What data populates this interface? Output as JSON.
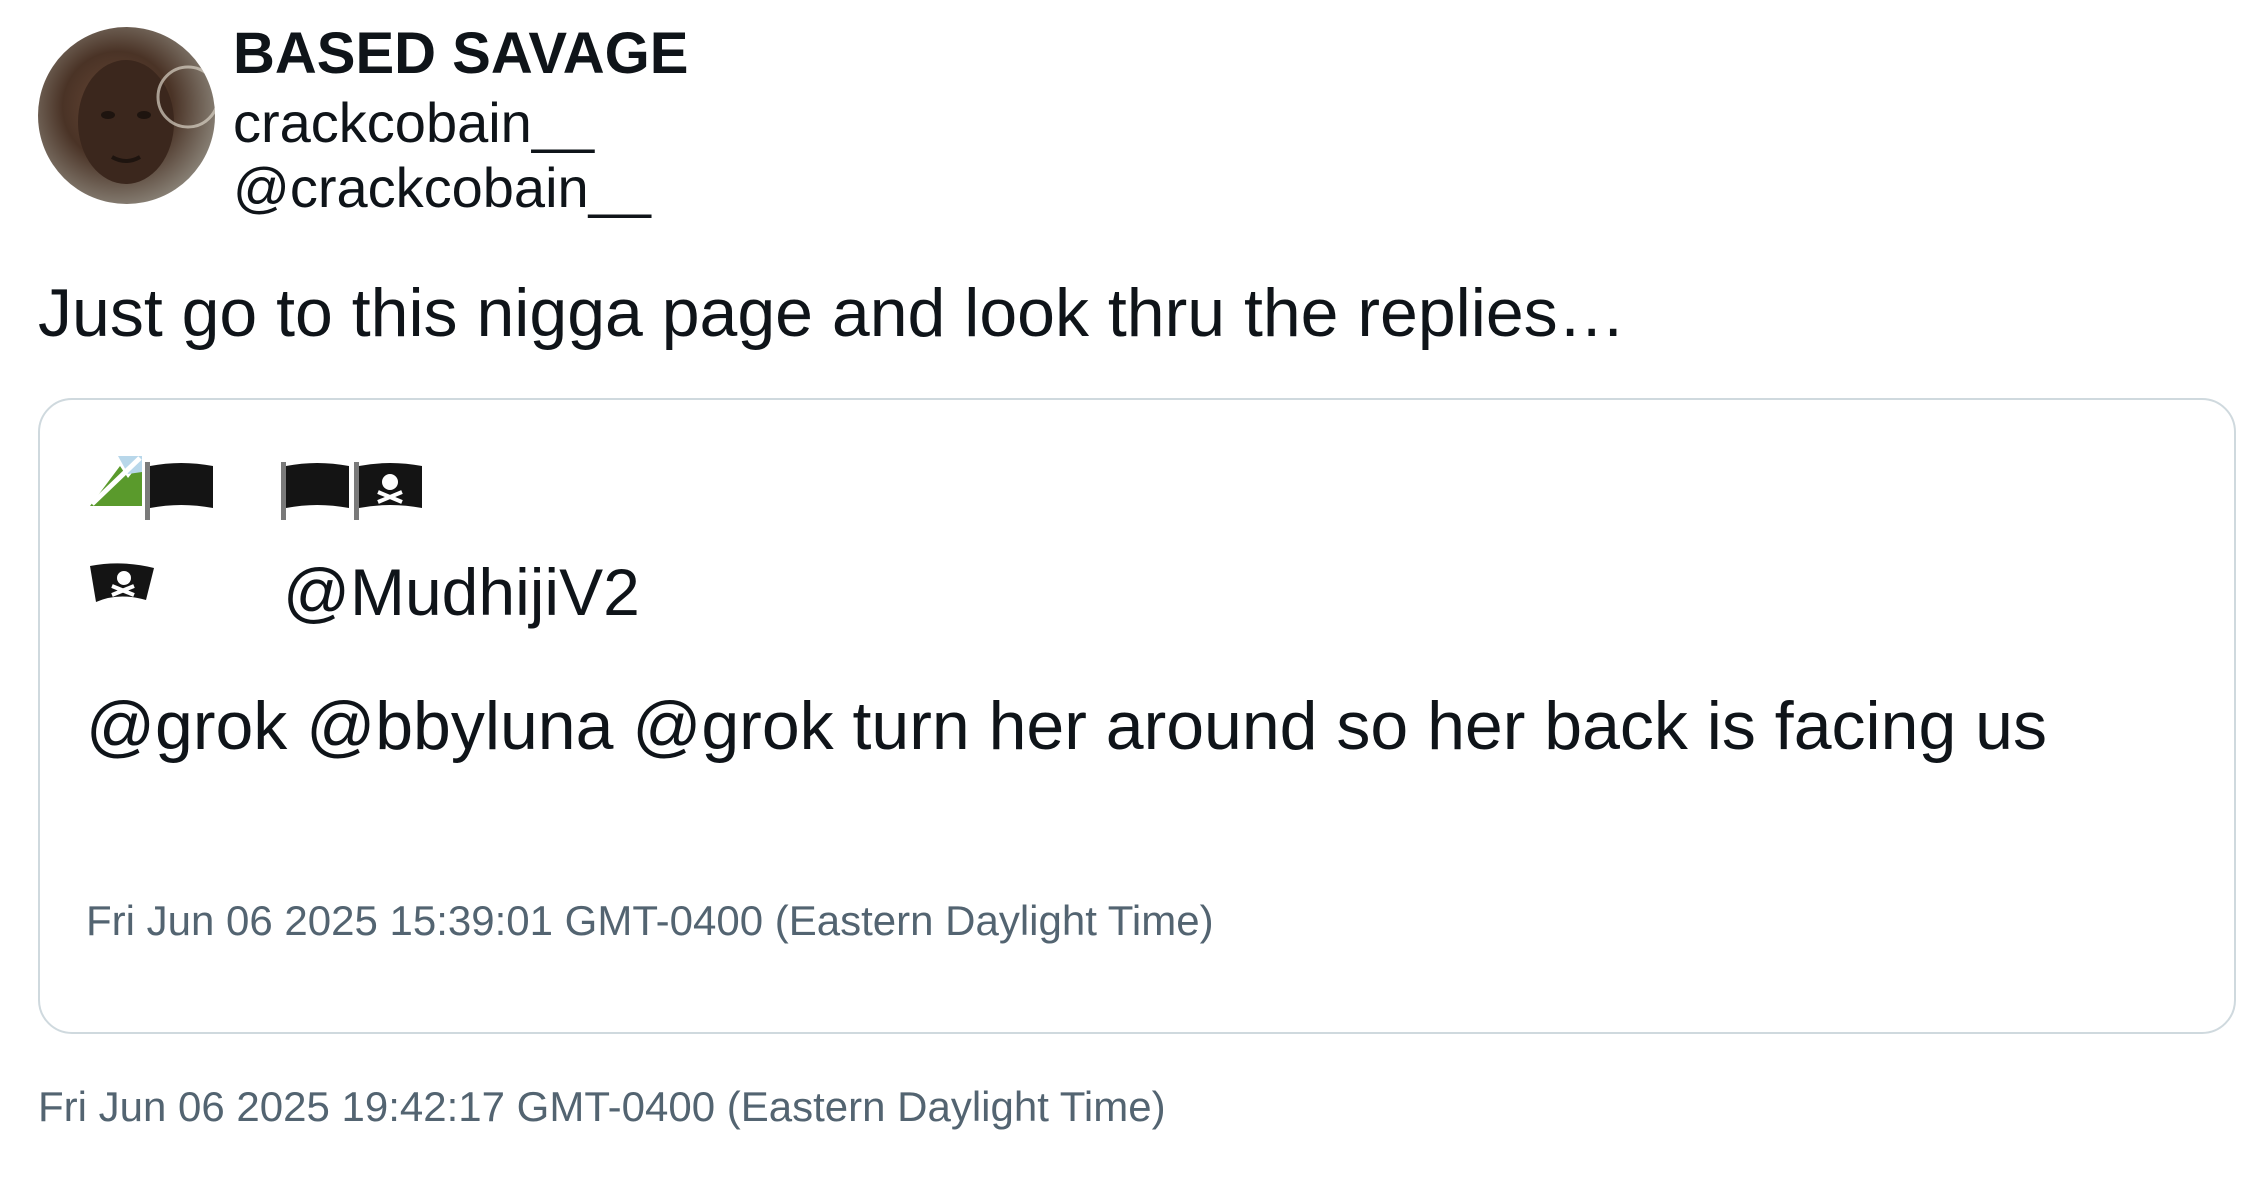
{
  "tweet": {
    "author_name": "BASED SAVAGE",
    "author_display": "crackcobain__",
    "author_handle": "@crackcobain__",
    "text": "Just go to this nigga page and look thru the replies…",
    "timestamp": "Fri Jun 06 2025 19:42:17 GMT-0400 (Eastern Daylight Time)",
    "avatar_icon": "avatar-photo"
  },
  "quoted_tweet": {
    "author_icons": [
      "broken-image-icon",
      "black-flag-icon",
      "black-flag-icon",
      "pirate-flag-icon",
      "pirate-flag-icon"
    ],
    "author_handle": "@MudhijiV2",
    "text": "@grok @bbyluna @grok turn her around so her back is facing us",
    "timestamp": "Fri Jun 06 2025 15:39:01 GMT-0400 (Eastern Daylight Time)"
  },
  "colors": {
    "text": "#0f1419",
    "secondary_text": "#536471",
    "border": "#cfd9de",
    "flag": "#141414"
  }
}
